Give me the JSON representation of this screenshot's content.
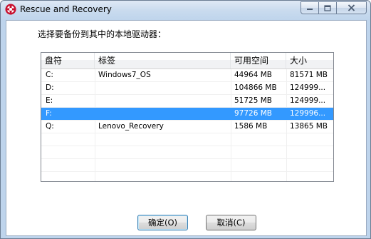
{
  "window": {
    "title": "Rescue and Recovery",
    "icon": "rescue-app-icon",
    "caption_buttons": [
      "minimize-icon",
      "maximize-icon",
      "close-icon"
    ]
  },
  "dialog": {
    "prompt": "选择要备份到其中的本地驱动器："
  },
  "drive_list": {
    "columns": [
      "盘符",
      "标签",
      "可用空间",
      "大小"
    ],
    "rows": [
      {
        "drive": "C:",
        "label": "Windows7_OS",
        "free": "44964 MB",
        "size": "81571 MB",
        "selected": false
      },
      {
        "drive": "D:",
        "label": "",
        "free": "104866 MB",
        "size": "124999...",
        "selected": false
      },
      {
        "drive": "E:",
        "label": "",
        "free": "51725 MB",
        "size": "124999...",
        "selected": false
      },
      {
        "drive": "F:",
        "label": "",
        "free": "97726 MB",
        "size": "129996...",
        "selected": true
      },
      {
        "drive": "Q:",
        "label": "Lenovo_Recovery",
        "free": "1586 MB",
        "size": "13865 MB",
        "selected": false
      }
    ],
    "selection_color": "#3399ff"
  },
  "buttons": {
    "ok_label": "确定(O)",
    "cancel_label": "取消(C)"
  }
}
